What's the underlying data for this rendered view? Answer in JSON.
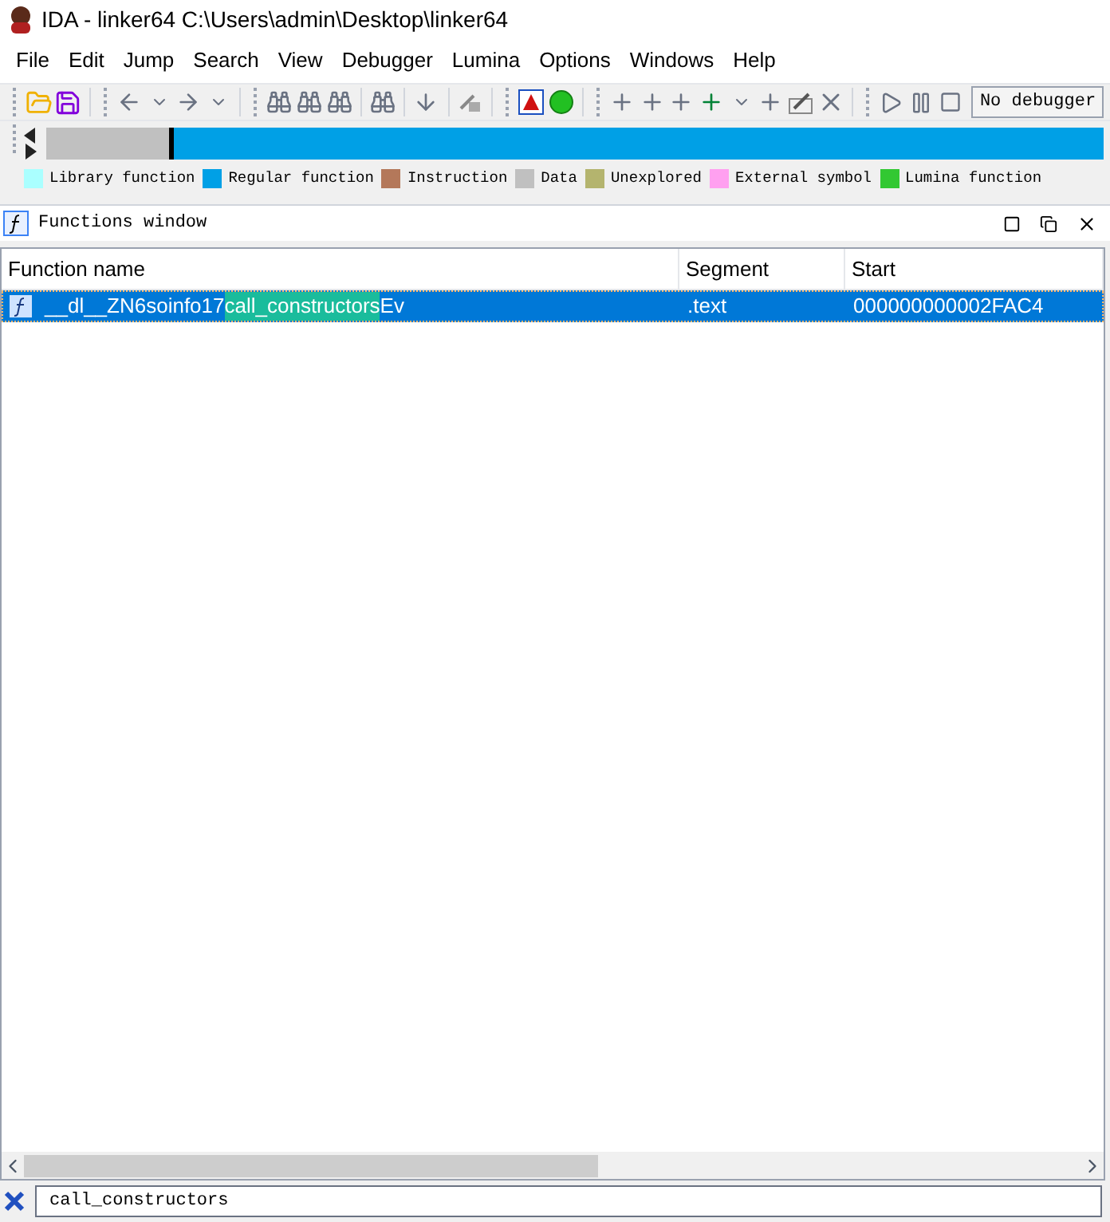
{
  "window": {
    "title": "IDA - linker64 C:\\Users\\admin\\Desktop\\linker64"
  },
  "menu": [
    "File",
    "Edit",
    "Jump",
    "Search",
    "View",
    "Debugger",
    "Lumina",
    "Options",
    "Windows",
    "Help"
  ],
  "toolbar": {
    "debugger_select": "No debugger"
  },
  "navigator": {
    "level": 0.12
  },
  "legend": [
    {
      "label": "Library function",
      "color": "#aaffff"
    },
    {
      "label": "Regular function",
      "color": "#00a0e6"
    },
    {
      "label": "Instruction",
      "color": "#b4785a"
    },
    {
      "label": "Data",
      "color": "#c0c0c0"
    },
    {
      "label": "Unexplored",
      "color": "#b4b46e"
    },
    {
      "label": "External symbol",
      "color": "#ffa0f0"
    },
    {
      "label": "Lumina function",
      "color": "#32c832"
    }
  ],
  "functions_window": {
    "title": "Functions window",
    "columns": [
      "Function name",
      "Segment",
      "Start"
    ],
    "rows": [
      {
        "name_before": "__dl__ZN6soinfo17",
        "name_match": "call_constructors",
        "name_after": "Ev",
        "segment": ".text",
        "start": "000000000002FAC4",
        "selected": true
      }
    ],
    "filter": "call_constructors"
  }
}
